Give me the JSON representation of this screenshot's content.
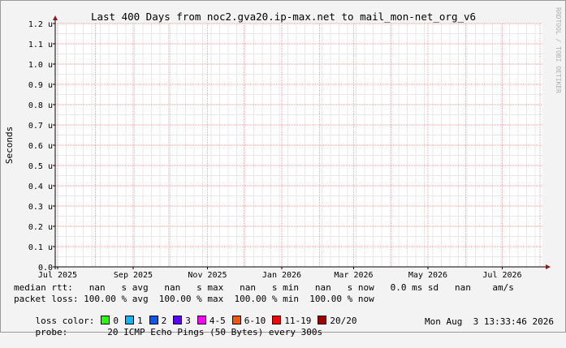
{
  "chart_data": {
    "type": "line",
    "title": "Last 400 Days from noc2.gva20.ip-max.net to mail_mon-net_org_v6",
    "ylabel": "Seconds",
    "xlabel": "",
    "ylim": [
      0,
      1.2
    ],
    "y_ticks": [
      "0.0",
      "0.1 u",
      "0.2 u",
      "0.3 u",
      "0.4 u",
      "0.5 u",
      "0.6 u",
      "0.7 u",
      "0.8 u",
      "0.9 u",
      "1.0 u",
      "1.1 u",
      "1.2 u"
    ],
    "y_tick_values": [
      0.0,
      0.1,
      0.2,
      0.3,
      0.4,
      0.5,
      0.6,
      0.7,
      0.8,
      0.9,
      1.0,
      1.1,
      1.2
    ],
    "x_ticks": [
      "Jul 2025",
      "Sep 2025",
      "Nov 2025",
      "Jan 2026",
      "Mar 2026",
      "May 2026",
      "Jul 2026"
    ],
    "x_tick_dates": [
      "2025-07-01",
      "2025-09-01",
      "2025-11-01",
      "2026-01-01",
      "2026-03-01",
      "2026-05-01",
      "2026-07-01"
    ],
    "x_range": [
      "2025-06-29",
      "2026-08-03"
    ],
    "grid": true,
    "series": []
  },
  "watermark": "RRDTOOL / TOBI OETIKER",
  "legend": {
    "median_rtt": "median rtt:   nan   s avg   nan   s max   nan   s min   nan   s now   0.0 ms sd   nan    am/s",
    "packet_loss": "packet loss: 100.00 % avg  100.00 % max  100.00 % min  100.00 % now",
    "loss_color_label": "loss color:",
    "loss_colors": [
      {
        "label": "0",
        "color": "#26ff00"
      },
      {
        "label": "1",
        "color": "#00b8ff"
      },
      {
        "label": "2",
        "color": "#0059ff"
      },
      {
        "label": "3",
        "color": "#5e00ff"
      },
      {
        "label": "4-5",
        "color": "#ff00ff"
      },
      {
        "label": "6-10",
        "color": "#ff5500"
      },
      {
        "label": "11-19",
        "color": "#ff0000"
      },
      {
        "label": "20/20",
        "color": "#a10000"
      }
    ],
    "probe_label": "probe:",
    "probe_text": "20 ICMP Echo Pings (50 Bytes) every 300s",
    "timestamp": "Mon Aug  3 13:33:46 2026"
  },
  "colors": {
    "background": "#f3f3f3",
    "canvas": "#ffffff",
    "grid_major": "#e6a8a8",
    "grid_minor": "#e8e8e8",
    "axis": "#000000",
    "arrow": "#8b1a1a"
  }
}
